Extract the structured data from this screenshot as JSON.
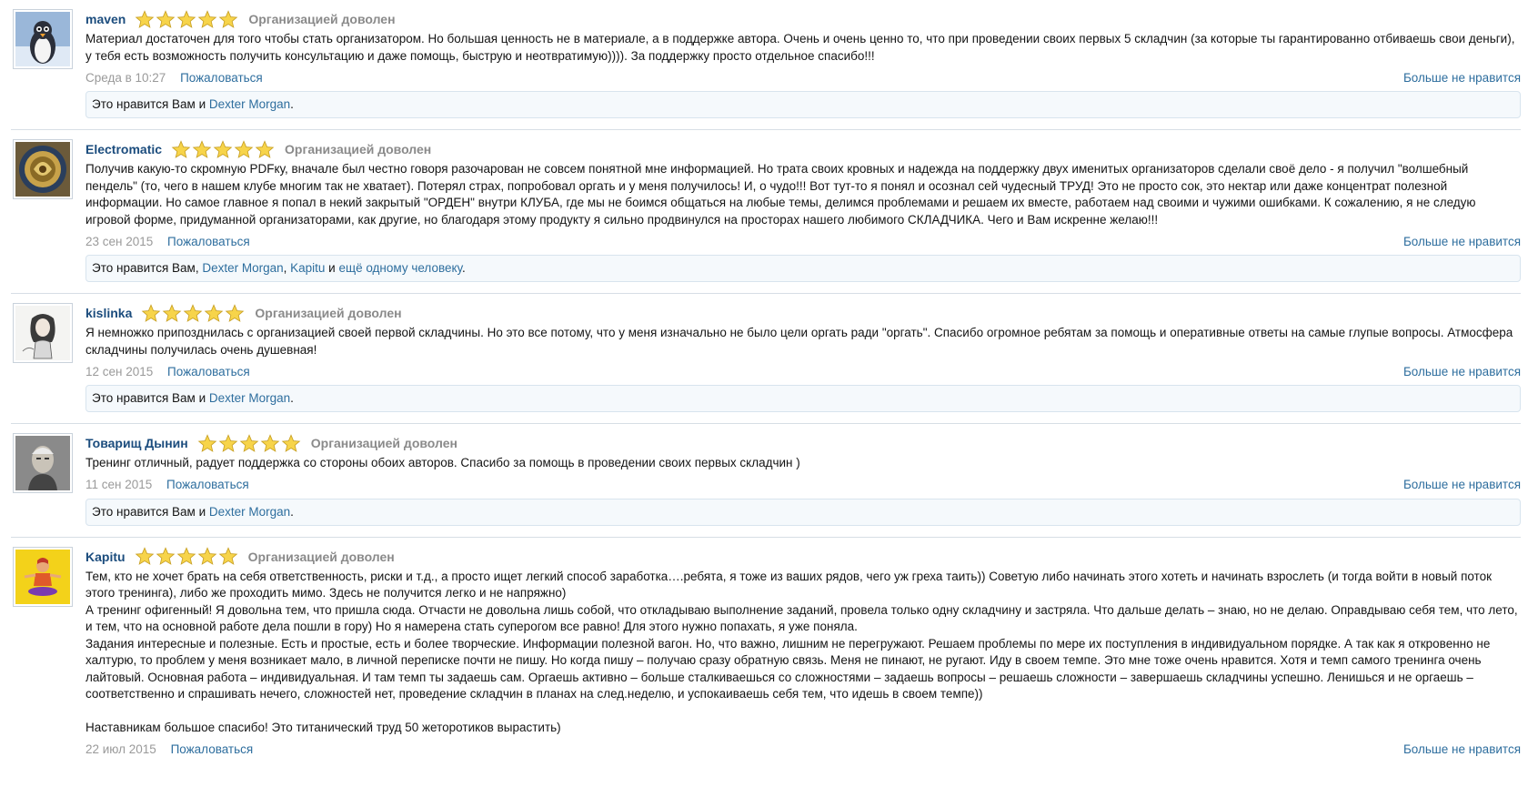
{
  "reviews": [
    {
      "username": "maven",
      "rating_text": "Организацией доволен",
      "text": "Материал достаточен для того чтобы стать организатором. Но большая ценность не в материале, а в поддержке автора. Очень и очень ценно то, что при проведении своих первых 5 складчин (за которые ты гарантированно отбиваешь свои деньги), у тебя есть возможность получить консультацию и даже помощь, быструю и неотвратимую)))). За поддержку просто отдельное спасибо!!!",
      "date": "Среда в 10:27",
      "report": "Пожаловаться",
      "unlike": "Больше не нравится",
      "likes_prefix": "Это нравится Вам и ",
      "likes_links": [
        "Dexter Morgan"
      ],
      "likes_suffix": "."
    },
    {
      "username": "Electromatic",
      "rating_text": "Организацией доволен",
      "text": "Получив какую-то скромную PDFку, вначале был честно говоря разочарован не совсем понятной мне информацией. Но трата своих кровных и надежда на поддержку двух именитых организаторов сделали своё дело - я получил \"волшебный пендель\" (то, чего в нашем клубе многим так не хватает). Потерял страх, попробовал оргать и у меня получилось! И, о чудо!!! Вот тут-то я понял и осознал сей чудесный ТРУД! Это не просто сок, это нектар или даже концентрат полезной информации. Но самое главное я попал в некий закрытый \"ОРДЕН\" внутри КЛУБА, где мы не боимся общаться на любые темы, делимся проблемами и решаем их вместе, работаем над своими и чужими ошибками. К сожалению, я не следую игровой форме, придуманной организаторами, как другие, но благодаря этому продукту я сильно продвинулся на просторах нашего любимого СКЛАДЧИКА. Чего и Вам искренне желаю!!!",
      "date": "23 сен 2015",
      "report": "Пожаловаться",
      "unlike": "Больше не нравится",
      "likes_prefix": "Это нравится Вам, ",
      "likes_links": [
        "Dexter Morgan",
        "Kapitu",
        "ещё одному человеку"
      ],
      "likes_seps": [
        ", ",
        " и "
      ],
      "likes_suffix": "."
    },
    {
      "username": "kislinka",
      "rating_text": "Организацией доволен",
      "text": "Я немножко припозднилась с организацией своей первой складчины. Но это все потому, что у меня изначально не было цели оргать ради \"оргать\". Спасибо огромное ребятам за помощь и оперативные ответы на самые глупые вопросы. Атмосфера складчины получилась очень душевная!",
      "date": "12 сен 2015",
      "report": "Пожаловаться",
      "unlike": "Больше не нравится",
      "likes_prefix": "Это нравится Вам и ",
      "likes_links": [
        "Dexter Morgan"
      ],
      "likes_suffix": "."
    },
    {
      "username": "Товарищ Дынин",
      "rating_text": "Организацией доволен",
      "text": "Тренинг отличный, радует поддержка со стороны обоих авторов. Спасибо за помощь в проведении своих первых складчин )",
      "date": "11 сен 2015",
      "report": "Пожаловаться",
      "unlike": "Больше не нравится",
      "likes_prefix": "Это нравится Вам и ",
      "likes_links": [
        "Dexter Morgan"
      ],
      "likes_suffix": "."
    },
    {
      "username": "Kapitu",
      "rating_text": "Организацией доволен",
      "text": "Тем, кто не хочет брать на себя ответственность, риски и т.д., а просто ищет легкий способ заработка….ребята, я тоже из ваших рядов, чего уж греха таить)) Советую либо начинать этого хотеть и начинать взрослеть (и тогда войти в новый поток этого тренинга), либо же проходить мимо. Здесь не получится легко и не напряжно)\nА тренинг офигенный! Я довольна тем, что пришла сюда. Отчасти не довольна лишь собой, что откладываю выполнение заданий, провела только одну складчину и застряла. Что дальше делать – знаю, но не делаю. Оправдываю себя тем, что лето, и тем, что на основной работе дела пошли в гору) Но я намерена стать суперогом все равно! Для этого нужно попахать, я уже поняла.\nЗадания интересные и полезные. Есть и простые, есть и более творческие. Информации полезной вагон. Но, что важно, лишним не перегружают. Решаем проблемы по мере их поступления в индивидуальном порядке. А так как я откровенно не халтурю, то проблем у меня возникает мало, в личной переписке почти не пишу. Но когда пишу – получаю сразу обратную связь. Меня не пинают, не ругают. Иду в своем темпе. Это мне тоже очень нравится. Хотя и темп самого тренинга очень лайтовый. Основная работа – индивидуальная. И там темп ты задаешь сам. Оргаешь активно – больше сталкиваешься со сложностями – задаешь вопросы – решаешь сложности – завершаешь складчины успешно. Ленишься и не оргаешь – соответственно и спрашивать нечего, сложностей нет, проведение складчин в планах на след.неделю, и успокаиваешь себя тем, что идешь в своем темпе))\n\nНаставникам большое спасибо! Это титанический труд 50 жеторотиков вырастить)",
      "date": "22 июл 2015",
      "report": "Пожаловаться",
      "unlike": "Больше не нравится",
      "likes_prefix": "",
      "likes_links": [],
      "likes_suffix": ""
    }
  ],
  "star_count": 5,
  "colors": {
    "link": "#2e6e9e",
    "username": "#1b4c7d",
    "star_fill": "#f7d44a",
    "star_stroke": "#c9a227",
    "likes_bg": "#f5f9fc"
  },
  "avatar_icons": [
    "penguin-avatar",
    "emblem-avatar",
    "sketch-girl-avatar",
    "old-man-photo-avatar",
    "yoga-cartoon-avatar"
  ]
}
